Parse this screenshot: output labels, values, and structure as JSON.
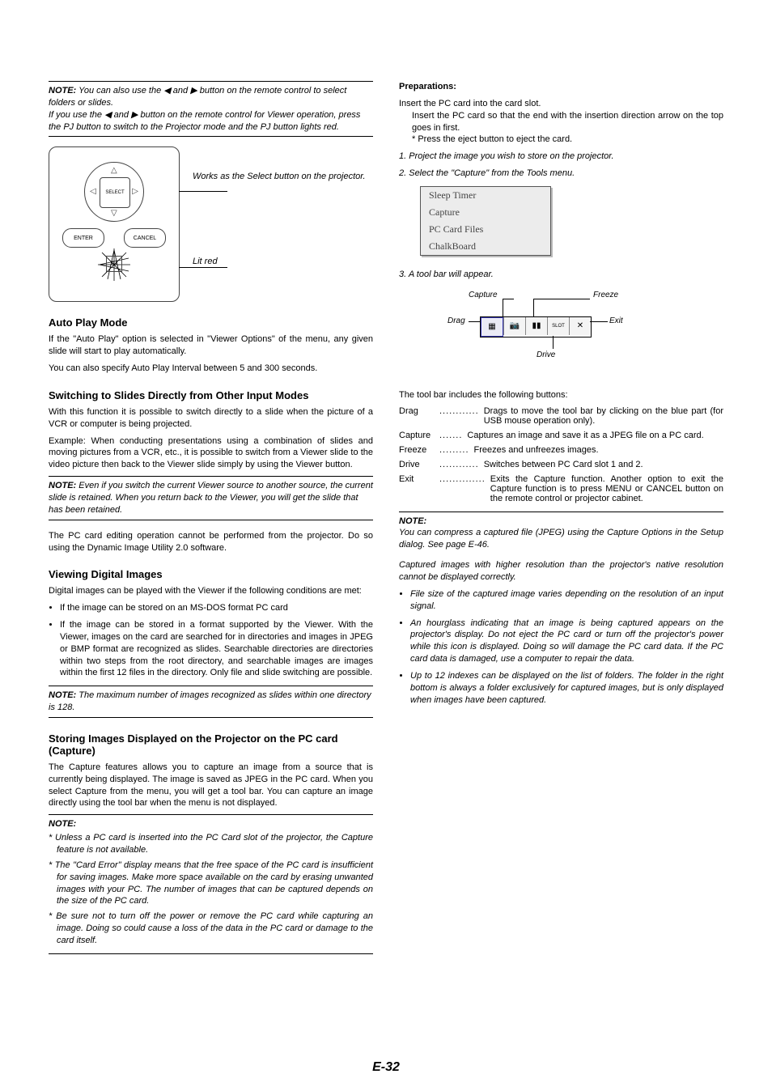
{
  "col1": {
    "note1": {
      "label": "NOTE:",
      "p1": "You can also use the ◀ and ▶ button on the remote control to select folders or slides.",
      "p2": "If you use the ◀ and ▶ button on the remote control for Viewer operation, press the PJ button to switch to the Projector mode and the PJ button lights red."
    },
    "remote": {
      "select": "SELECT",
      "enter": "ENTER",
      "cancel": "CANCEL",
      "pj": "PJ"
    },
    "fig_caption_1": "Works as the Select button on the projector.",
    "fig_caption_2": "Lit red",
    "h1": "Auto Play Mode",
    "p1a": "If the \"Auto Play\" option is selected in \"Viewer Options\" of the menu, any given slide will start to play automatically.",
    "p1b": "You can also specify Auto Play Interval between 5 and 300 seconds.",
    "h2": "Switching to Slides Directly from Other Input Modes",
    "p2a": "With this function it is possible to switch directly to a slide when the picture of a VCR or computer is being projected.",
    "p2b": "Example: When conducting presentations using a combination of slides and moving pictures from a VCR, etc., it is possible to switch from a Viewer slide to the video picture then back to the Viewer slide simply by using the Viewer button.",
    "note2": {
      "label": "NOTE:",
      "p": "Even if you switch the current Viewer source to another source, the current slide is retained. When you return back to the Viewer, you will get the slide that has been retained."
    },
    "p2c": "The PC card editing operation cannot be performed from the projector. Do so using the Dynamic Image Utility 2.0 software.",
    "h3": "Viewing Digital Images",
    "p3a": "Digital images can be played with the Viewer if the following conditions are met:",
    "bullets": [
      "If the image can be stored on an MS-DOS format PC card",
      "If the image can be stored in a format supported by the Viewer. With the Viewer, images on the card are searched for in directories and images in JPEG or BMP format are recognized as slides. Searchable directories are directories within two steps from the root directory, and searchable images are images within the first 12 files in the directory. Only file and slide switching are possible."
    ],
    "note3": {
      "label": "NOTE:",
      "p": "The maximum number of images recognized as slides within one directory is 128."
    },
    "h4": "Storing Images Displayed on the Projector on the PC card (Capture)",
    "p4a": "The Capture features allows you to capture an image from a source that is currently being displayed. The image is saved as JPEG in the PC card. When you select Capture from the menu, you will get a tool bar. You can capture an image directly using the tool bar when the menu is not displayed.",
    "note4": {
      "label": "NOTE:",
      "items": [
        "* Unless a PC card is inserted into the PC Card slot of the projector, the Capture feature is not available.",
        "* The \"Card Error\" display means that the free space of the PC card is insufficient for saving images. Make more space available on the card by erasing unwanted images with your PC. The number of images that can be captured depends on the size of the PC card.",
        "* Be sure not to turn off the power or remove the PC card while capturing an image. Doing so could cause a loss of the data in the PC card or damage to the card itself."
      ]
    }
  },
  "col2": {
    "prep_title": "Preparations:",
    "prep_p1": "Insert the PC card into the card slot.",
    "prep_p2": "Insert the PC card so that the end with the insertion direction arrow on the top goes in first.",
    "prep_p3": "* Press the eject button to eject the card.",
    "step1": "1. Project the image you wish to store on the projector.",
    "step2": "2. Select the \"Capture\" from the Tools menu.",
    "menu_items": [
      "Sleep Timer",
      "Capture",
      "PC Card Files",
      "ChalkBoard"
    ],
    "step3": "3. A tool bar will appear.",
    "toolbar": {
      "capture": "Capture",
      "drag": "Drag",
      "freeze": "Freeze",
      "exit": "Exit",
      "drive": "Drive",
      "btn_drag": "▦",
      "btn_capture": "📷",
      "btn_freeze": "▮▮",
      "btn_drive_label": "SLOT",
      "btn_exit": "✕"
    },
    "p_after_toolbar": "The tool bar includes the following buttons:",
    "defs": [
      {
        "key": "Drag",
        "dots": "............",
        "val": "Drags to move the tool bar by clicking on the blue part (for USB mouse operation only)."
      },
      {
        "key": "Capture",
        "dots": ".......",
        "val": "Captures an image and save it as a JPEG file on a PC card."
      },
      {
        "key": "Freeze",
        "dots": ".........",
        "val": "Freezes and unfreezes images."
      },
      {
        "key": "Drive",
        "dots": "............",
        "val": "Switches between PC Card slot 1 and 2."
      },
      {
        "key": "Exit",
        "dots": "..............",
        "val": "Exits the Capture function. Another option to exit the Capture function is to press MENU or CANCEL button on the remote control or projector cabinet."
      }
    ],
    "note5": {
      "label": "NOTE:",
      "p1": "You can compress a captured file (JPEG) using the Capture Options in the Setup dialog. See page E-46.",
      "p2": "Captured images with higher resolution than the projector's native resolution cannot be displayed correctly.",
      "bullets": [
        "File size of the captured image varies depending on the resolution of an input signal.",
        "An hourglass indicating that an image is being captured appears on the projector's display. Do not eject the PC card or turn off the projector's power while this icon is displayed. Doing so will damage the PC card data. If the PC card data is damaged, use a computer to repair the data.",
        "Up to 12 indexes can be displayed on the list of folders. The folder in the right bottom is always a folder exclusively for captured images, but is only displayed when images have been captured."
      ]
    }
  },
  "page_number": "E-32"
}
